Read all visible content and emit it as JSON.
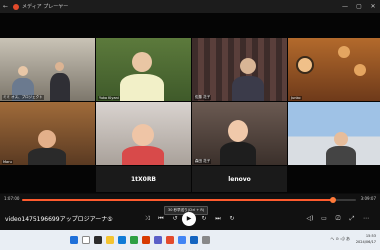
{
  "window": {
    "title": "メディア プレーヤー",
    "back_icon": "back-arrow-icon",
    "min": "—",
    "max": "▢",
    "close": "✕"
  },
  "tiles": [
    {
      "id": "t1",
      "label": "ミミ オス、プロジェクト",
      "kind": "room"
    },
    {
      "id": "t2",
      "label": "Yuko Kiyani",
      "kind": "person"
    },
    {
      "id": "t3",
      "label": "佐藤 花子",
      "kind": "curtain"
    },
    {
      "id": "t4",
      "label": "ゆみ",
      "kind": "person"
    },
    {
      "id": "t5",
      "label": "Junko",
      "kind": "room"
    },
    {
      "id": "t6",
      "label": "Maru",
      "kind": "person"
    },
    {
      "id": "t7",
      "label": "",
      "kind": "person"
    },
    {
      "id": "t8",
      "label": "森田 花子",
      "kind": "person"
    },
    {
      "id": "t9",
      "label": "",
      "kind": "person"
    },
    {
      "id": "t10",
      "label": "1tX0RB",
      "kind": "name"
    },
    {
      "id": "t11",
      "label": "lenovo",
      "kind": "name"
    }
  ],
  "player": {
    "time_elapsed": "1:07:00",
    "time_total": "3:09:07",
    "progress": 0.93,
    "media_title": "video1475196699アップロジアーナ⑤",
    "tooltip": "30 秒早送り(Ctrl + R)",
    "play_glyph": "▶",
    "accent": "#ff5b2e"
  },
  "taskbar": {
    "clock": "15:53",
    "date": "2024/06/17",
    "tray_text": "へ ⊙ ◁) あ"
  }
}
